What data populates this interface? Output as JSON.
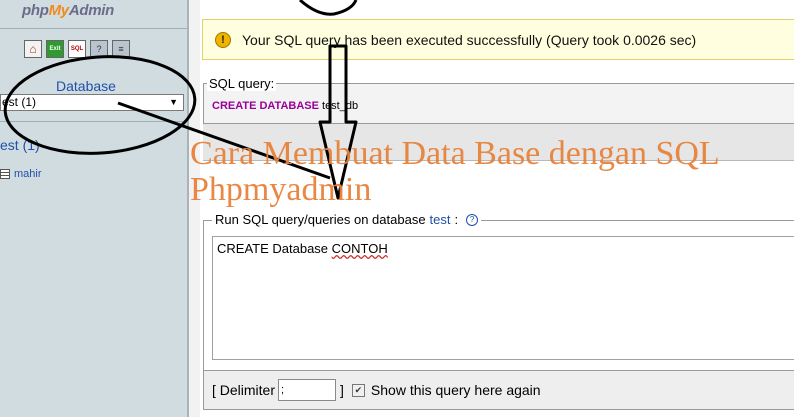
{
  "nav": {
    "logo_php": "php",
    "logo_my": "My",
    "logo_admin": "Admin",
    "icons": [
      "home-icon",
      "exit-icon",
      "sql-icon",
      "help-icon",
      "docs-icon"
    ],
    "icon_glyphs": {
      "home": "⌂",
      "exit": "Exit",
      "sql": "SQL",
      "help": "?",
      "docs": "≡"
    },
    "database_label": "Database",
    "database_select_value": "est (1)",
    "database_link": "est (1)",
    "tables": [
      {
        "name": "mahir"
      }
    ]
  },
  "message": {
    "icon": "!",
    "text": "Your SQL query has been executed successfully (Query took 0.0026 sec)"
  },
  "sql_query": {
    "legend": "SQL query:",
    "keyword": "CREATE DATABASE",
    "rest": " test_db"
  },
  "run_query": {
    "legend_prefix": "Run SQL query/queries on database",
    "database": "test",
    "legend_suffix": ":",
    "help_glyph": "?",
    "query_prefix": "CREATE Database ",
    "query_word": "CONTOH"
  },
  "bottom": {
    "delimiter_open": "[ Delimiter",
    "delimiter_value": ";",
    "delimiter_close": "]",
    "checkbox_glyph": "✔",
    "show_label": "Show this query here again"
  },
  "overlay": {
    "watermark_line1": "Cara Membuat Data Base dengan SQL",
    "watermark_line2": "Phpmyadmin"
  },
  "colors": {
    "nav_bg": "#d0dce0",
    "link": "#2150a8",
    "keyword": "#990099",
    "watermark": "#e8823c",
    "success_bg": "#ffffe0"
  }
}
